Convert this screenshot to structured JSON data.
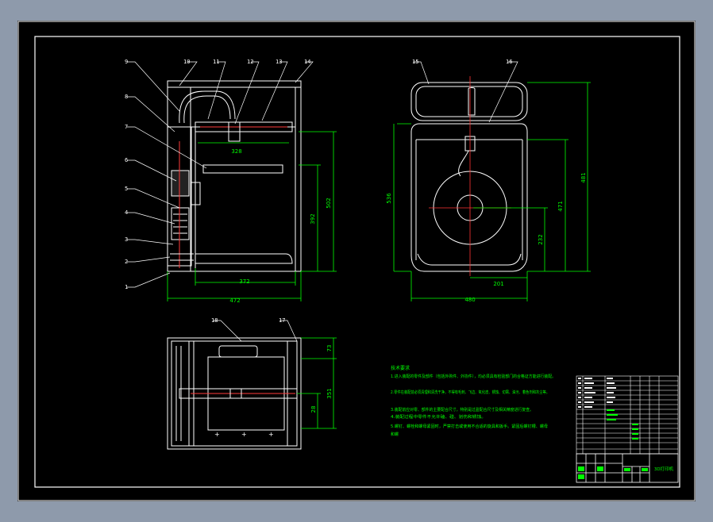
{
  "colors": {
    "background": "#8e9aab",
    "sheet": "#000000",
    "line": "#ffffff",
    "dimension": "#00ff00",
    "centerline": "#ff0000"
  },
  "drawing": {
    "part_numbers": [
      "1",
      "2",
      "3",
      "4",
      "5",
      "6",
      "7",
      "8",
      "9",
      "10",
      "11",
      "12",
      "13",
      "14",
      "15",
      "16",
      "17",
      "18"
    ],
    "front_view_dims": {
      "inner_top_width": "328",
      "inner_bottom_width": "372",
      "overall_width": "472",
      "right_height_1": "392",
      "right_height_2": "502"
    },
    "side_view_dims": {
      "left_height": "536",
      "right_height_1": "471",
      "right_height_2": "481",
      "center_height": "232",
      "center_width": "201",
      "overall_width": "480"
    },
    "top_view_dims": {
      "right_1": "73",
      "right_2": "351",
      "right_3": "28"
    },
    "notes_title": "技术要求",
    "notes": [
      "1.进入装配的零件及部件（包括外购件、外协件），均必须具有检验部门的合格证方能进行装配。",
      "2.零件在装配前必须清理和清洗干净，不得有毛刺、飞边、氧化皮、锈蚀、切屑、油污、着色剂和灰尘等。",
      "3.装配前应对零、部件的主要配合尺寸，特别是过盈配合尺寸及相关精度进行复查。",
      "4.装配过程中零件不允许磕、碰、划伤和锈蚀。",
      "5.螺钉、螺栓和螺母紧固时，严禁打击或使用不合适的旋具和扳手。紧固后螺钉槽、螺母"
    ],
    "notes_tail": "和螺",
    "title_block_name": "3D打印机"
  }
}
